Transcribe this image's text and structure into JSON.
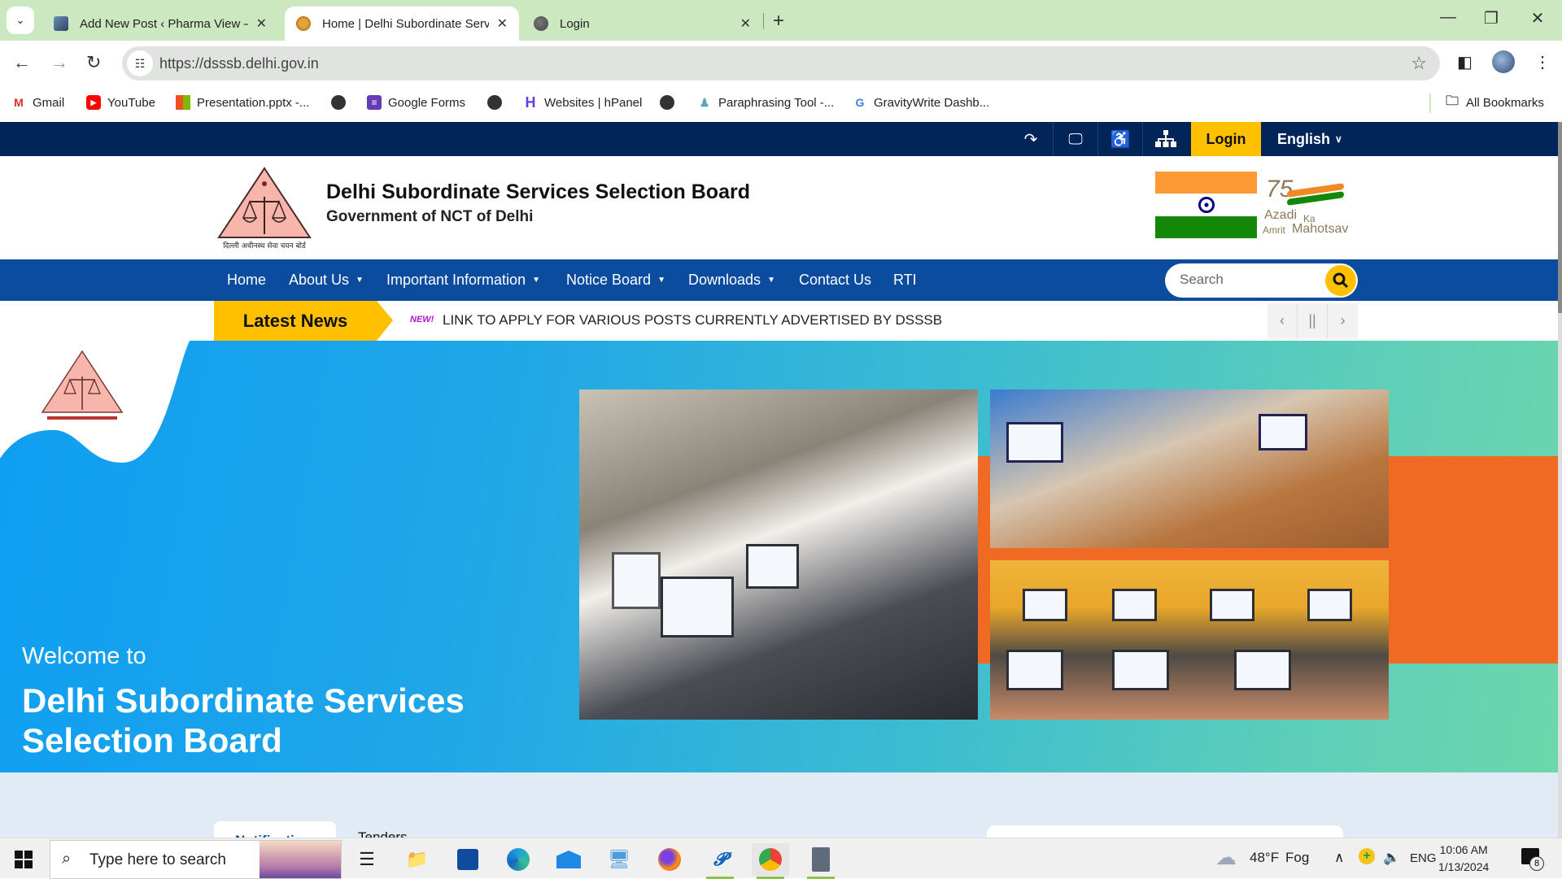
{
  "browser": {
    "tabs": [
      {
        "title": "Add New Post ‹ Pharma View — ",
        "active": false,
        "favicon": "profile-thumbnail"
      },
      {
        "title": "Home | Delhi Subordinate Servi",
        "active": true,
        "favicon": "emblem-icon"
      },
      {
        "title": "Login",
        "active": false,
        "favicon": "globe-icon"
      }
    ],
    "new_tab": "+",
    "url": "https://dsssb.delhi.gov.in",
    "bookmarks": [
      {
        "label": "Gmail",
        "icon": "gmail-icon"
      },
      {
        "label": "YouTube",
        "icon": "youtube-icon"
      },
      {
        "label": "Presentation.pptx -...",
        "icon": "microsoft-icon"
      },
      {
        "label": "",
        "icon": "globe-icon"
      },
      {
        "label": "Google Forms",
        "icon": "google-forms-icon"
      },
      {
        "label": "",
        "icon": "globe-icon"
      },
      {
        "label": "Websites | hPanel",
        "icon": "hostinger-icon"
      },
      {
        "label": "",
        "icon": "globe-icon"
      },
      {
        "label": "Paraphrasing Tool -...",
        "icon": "paraphrase-icon"
      },
      {
        "label": "GravityWrite Dashb...",
        "icon": "gravitywrite-icon"
      }
    ],
    "all_bookmarks": "All Bookmarks"
  },
  "site": {
    "utility": {
      "login": "Login",
      "language": "English",
      "icons": [
        "skip-to-content-icon",
        "screen-reader-icon",
        "accessibility-icon",
        "sitemap-icon"
      ]
    },
    "header": {
      "title": "Delhi Subordinate Services Selection Board",
      "subtitle": "Government of NCT of Delhi",
      "logo_caption": "दिल्ली अधीनस्थ सेवा चयन बोर्ड",
      "aka": {
        "number": "75",
        "line1": "Azadi",
        "ka": "Ka",
        "amrit": "Amrit",
        "mahotsav": "Mahotsav"
      }
    },
    "nav": [
      {
        "label": "Home",
        "dropdown": false
      },
      {
        "label": "About Us",
        "dropdown": true
      },
      {
        "label": "Important Information",
        "dropdown": true
      },
      {
        "label": "Notice Board",
        "dropdown": true
      },
      {
        "label": "Downloads",
        "dropdown": true
      },
      {
        "label": "Contact Us",
        "dropdown": false
      },
      {
        "label": "RTI",
        "dropdown": false
      }
    ],
    "search": {
      "placeholder": "Search",
      "value": ""
    },
    "news": {
      "label": "Latest News",
      "badge": "NEW!",
      "text": "LINK TO APPLY FOR VARIOUS POSTS CURRENTLY ADVERTISED BY DSSSB",
      "controls": [
        "‹",
        "||",
        "›"
      ]
    },
    "banner": {
      "welcome": "Welcome to",
      "title_line1": "Delhi Subordinate Services",
      "title_line2": "Selection Board",
      "slide_count": 2,
      "active_slide": 1
    },
    "tabs": [
      {
        "label": "Notifications",
        "active": true
      },
      {
        "label": "Tenders",
        "active": false
      }
    ]
  },
  "taskbar": {
    "search_placeholder": "Type here to search",
    "apps": [
      "task-view-icon",
      "file-explorer-icon",
      "microsoft-store-icon",
      "edge-icon",
      "mail-icon",
      "network-computer-icon",
      "firefox-icon",
      "editor-app-icon",
      "chrome-icon",
      "calculator-icon"
    ],
    "weather": {
      "temp": "48°F",
      "condition": "Fog"
    },
    "language": "ENG",
    "time": "10:06 AM",
    "date": "1/13/2024",
    "notifications": "8"
  },
  "colors": {
    "utility_bar": "#012459",
    "nav_bar": "#0b4c9e",
    "accent_yellow": "#ffc000",
    "tab_strip": "#cbe8c0"
  }
}
